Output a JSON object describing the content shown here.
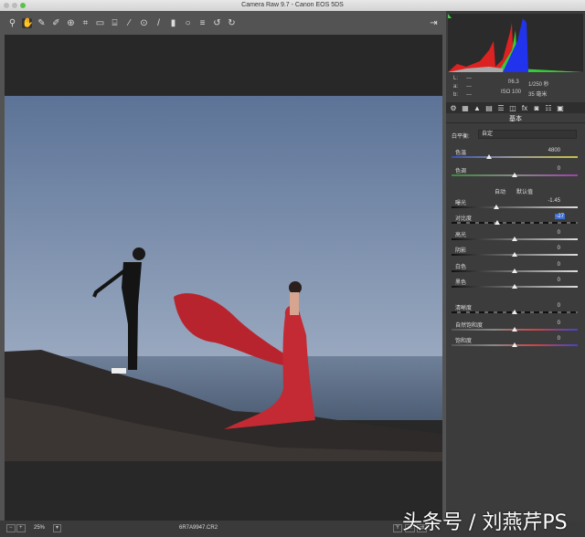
{
  "window": {
    "title": "Camera Raw 9.7 -  Canon EOS 5DS"
  },
  "toolbar": {
    "tools": [
      {
        "name": "zoom-tool-icon",
        "glyph": "⚲"
      },
      {
        "name": "hand-tool-icon",
        "glyph": "✋"
      },
      {
        "name": "white-balance-tool-icon",
        "glyph": "✎"
      },
      {
        "name": "color-sampler-icon",
        "glyph": "✐"
      },
      {
        "name": "targeted-adjustment-icon",
        "glyph": "⊕"
      },
      {
        "name": "crop-tool-icon",
        "glyph": "⌗"
      },
      {
        "name": "straighten-tool-icon",
        "glyph": "▭"
      },
      {
        "name": "transform-tool-icon",
        "glyph": "⌸"
      },
      {
        "name": "spot-removal-icon",
        "glyph": "⁄"
      },
      {
        "name": "red-eye-icon",
        "glyph": "⊙"
      },
      {
        "name": "adjustment-brush-icon",
        "glyph": "/"
      },
      {
        "name": "graduated-filter-icon",
        "glyph": "▮"
      },
      {
        "name": "radial-filter-icon",
        "glyph": "○"
      },
      {
        "name": "preferences-icon",
        "glyph": "≡"
      },
      {
        "name": "rotate-left-icon",
        "glyph": "↺"
      },
      {
        "name": "rotate-right-icon",
        "glyph": "↻"
      }
    ],
    "exit_glyph": "⇥"
  },
  "info": {
    "r": "L:",
    "g": "a:",
    "b": "b:",
    "dash": "---",
    "aperture": "f/6.3",
    "shutter": "1/250 秒",
    "iso": "ISO 100",
    "focal": "35 毫米"
  },
  "panel_tabs": [
    "⚙",
    "▦",
    "▲",
    "▤",
    "☰",
    "◫",
    "fx",
    "◙",
    "☷",
    "▣"
  ],
  "section_title": "基本",
  "white_balance": {
    "label": "白平衡:",
    "value": "自定"
  },
  "auto_label": "自动",
  "default_label": "默认值",
  "sliders": [
    {
      "label": "色温",
      "value": "4800",
      "position": 0.3,
      "track": "temp"
    },
    {
      "label": "色调",
      "value": "0",
      "position": 0.5,
      "track": "tint"
    },
    {
      "label": "曝光",
      "value": "-1.45",
      "position": 0.355,
      "track": "gray"
    },
    {
      "label": "对比度",
      "value": "-27",
      "position": 0.365,
      "track": "dash",
      "highlight": true
    },
    {
      "label": "高光",
      "value": "0",
      "position": 0.5,
      "track": "gray"
    },
    {
      "label": "阴影",
      "value": "0",
      "position": 0.5,
      "track": "gray"
    },
    {
      "label": "白色",
      "value": "0",
      "position": 0.5,
      "track": "gray"
    },
    {
      "label": "黑色",
      "value": "0",
      "position": 0.5,
      "track": "gray"
    },
    {
      "label": "清晰度",
      "value": "0",
      "position": 0.5,
      "track": "dash"
    },
    {
      "label": "自然饱和度",
      "value": "0",
      "position": 0.5,
      "track": "sat"
    },
    {
      "label": "饱和度",
      "value": "0",
      "position": 0.5,
      "track": "sat"
    }
  ],
  "bottom": {
    "zoom": "25%",
    "filename": "6R7A9947.CR2",
    "compare": "Y"
  },
  "watermark": "头条号 / 刘燕芹PS",
  "colors": {
    "bg": "#535353",
    "panel": "#3c3c3c",
    "highlight": "#3d6fd0"
  }
}
